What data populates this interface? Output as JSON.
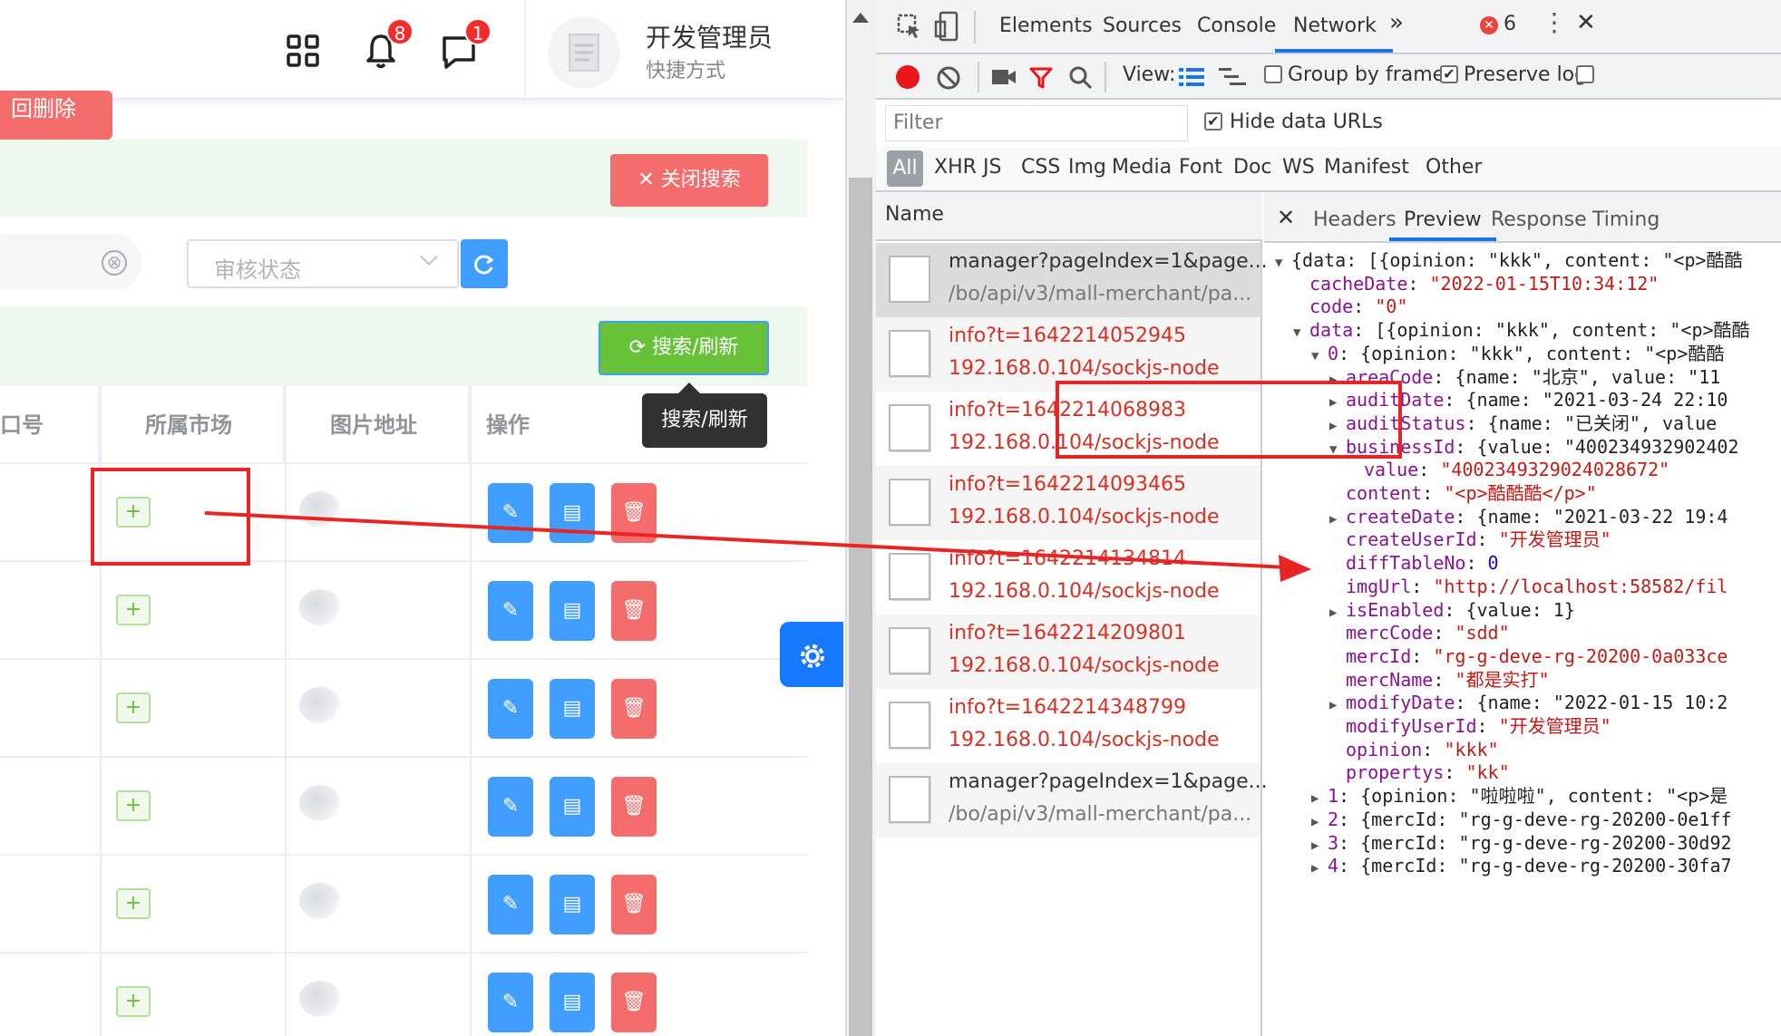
{
  "app": {
    "badges": {
      "bell": "8",
      "chat": "1"
    },
    "user": {
      "name": "开发管理员",
      "subtitle": "快捷方式"
    },
    "batch_delete_label": "回删除",
    "close_search_label": "关闭搜索",
    "keyword_clear_glyph": "⊗",
    "audit_status_placeholder": "审核状态",
    "search_refresh_label": "搜索/刷新",
    "tooltip": "搜索/刷新",
    "table": {
      "headers": [
        "口号",
        "所属市场",
        "图片地址",
        "操作"
      ],
      "rows": 6,
      "plus_glyph": "+"
    }
  },
  "devtools": {
    "tabs": [
      "Elements",
      "Sources",
      "Console",
      "Network"
    ],
    "more_tabs": "»",
    "error_count": "6",
    "toolbar": {
      "view_label": "View:",
      "group_by_frame": "Group by frame",
      "preserve_log": "Preserve log"
    },
    "filter_placeholder": "Filter",
    "hide_data_urls": "Hide data URLs",
    "types": [
      "All",
      "XHR",
      "JS",
      "CSS",
      "Img",
      "Media",
      "Font",
      "Doc",
      "WS",
      "Manifest",
      "Other"
    ],
    "name_header": "Name",
    "requests": [
      {
        "name": "manager?pageIndex=1&page...",
        "path": "/bo/api/v3/mall-merchant/pa...",
        "error": false,
        "selected": true
      },
      {
        "name": "info?t=1642214052945",
        "path": "192.168.0.104/sockjs-node",
        "error": true
      },
      {
        "name": "info?t=1642214068983",
        "path": "192.168.0.104/sockjs-node",
        "error": true
      },
      {
        "name": "info?t=1642214093465",
        "path": "192.168.0.104/sockjs-node",
        "error": true
      },
      {
        "name": "info?t=1642214134814",
        "path": "192.168.0.104/sockjs-node",
        "error": true
      },
      {
        "name": "info?t=1642214209801",
        "path": "192.168.0.104/sockjs-node",
        "error": true
      },
      {
        "name": "info?t=1642214348799",
        "path": "192.168.0.104/sockjs-node",
        "error": true
      },
      {
        "name": "manager?pageIndex=1&page...",
        "path": "/bo/api/v3/mall-merchant/pa...",
        "error": false
      }
    ],
    "preview_tabs": [
      "Headers",
      "Preview",
      "Response",
      "Timing"
    ],
    "json_lines": [
      {
        "i": 0,
        "t": "▼",
        "k": "",
        "v": "{data: [{opinion: \"kkk\", content: \"<p>酷酷",
        "c": "plain"
      },
      {
        "i": 1,
        "t": "",
        "k": "cacheDate",
        "v": "\"2022-01-15T10:34:12\"",
        "c": "str"
      },
      {
        "i": 1,
        "t": "",
        "k": "code",
        "v": "\"0\"",
        "c": "str"
      },
      {
        "i": 1,
        "t": "▼",
        "k": "data",
        "v": "[{opinion: \"kkk\", content: \"<p>酷酷",
        "c": "plain"
      },
      {
        "i": 2,
        "t": "▼",
        "k": "0",
        "v": "{opinion: \"kkk\", content: \"<p>酷酷",
        "c": "plain"
      },
      {
        "i": 3,
        "t": "▶",
        "k": "areaCode",
        "v": "{name: \"北京\", value: \"11",
        "c": "plain"
      },
      {
        "i": 3,
        "t": "▶",
        "k": "auditDate",
        "v": "{name: \"2021-03-24 22:10",
        "c": "plain"
      },
      {
        "i": 3,
        "t": "▶",
        "k": "auditStatus",
        "v": "{name: \"已关闭\", value",
        "c": "plain"
      },
      {
        "i": 3,
        "t": "▼",
        "k": "businessId",
        "v": "{value: \"400234932902402",
        "c": "plain"
      },
      {
        "i": 4,
        "t": "",
        "k": "value",
        "v": "\"4002349329024028672\"",
        "c": "str"
      },
      {
        "i": 3,
        "t": "",
        "k": "content",
        "v": "\"<p>酷酷酷</p>\"",
        "c": "str"
      },
      {
        "i": 3,
        "t": "▶",
        "k": "createDate",
        "v": "{name: \"2021-03-22 19:4",
        "c": "plain"
      },
      {
        "i": 3,
        "t": "",
        "k": "createUserId",
        "v": "\"开发管理员\"",
        "c": "str"
      },
      {
        "i": 3,
        "t": "",
        "k": "diffTableNo",
        "v": "0",
        "c": "num"
      },
      {
        "i": 3,
        "t": "",
        "k": "imgUrl",
        "v": "\"http://localhost:58582/fil",
        "c": "str"
      },
      {
        "i": 3,
        "t": "▶",
        "k": "isEnabled",
        "v": "{value: 1}",
        "c": "plain"
      },
      {
        "i": 3,
        "t": "",
        "k": "mercCode",
        "v": "\"sdd\"",
        "c": "str"
      },
      {
        "i": 3,
        "t": "",
        "k": "mercId",
        "v": "\"rg-g-deve-rg-20200-0a033ce",
        "c": "str"
      },
      {
        "i": 3,
        "t": "",
        "k": "mercName",
        "v": "\"都是实打\"",
        "c": "str"
      },
      {
        "i": 3,
        "t": "▶",
        "k": "modifyDate",
        "v": "{name: \"2022-01-15 10:2",
        "c": "plain"
      },
      {
        "i": 3,
        "t": "",
        "k": "modifyUserId",
        "v": "\"开发管理员\"",
        "c": "str"
      },
      {
        "i": 3,
        "t": "",
        "k": "opinion",
        "v": "\"kkk\"",
        "c": "str"
      },
      {
        "i": 3,
        "t": "",
        "k": "propertys",
        "v": "\"kk\"",
        "c": "str"
      },
      {
        "i": 2,
        "t": "▶",
        "k": "1",
        "v": "{opinion: \"啦啦啦\", content: \"<p>是",
        "c": "plain"
      },
      {
        "i": 2,
        "t": "▶",
        "k": "2",
        "v": "{mercId: \"rg-g-deve-rg-20200-0e1ff",
        "c": "plain"
      },
      {
        "i": 2,
        "t": "▶",
        "k": "3",
        "v": "{mercId: \"rg-g-deve-rg-20200-30d92",
        "c": "plain"
      },
      {
        "i": 2,
        "t": "▶",
        "k": "4",
        "v": "{mercId: \"rg-g-deve-rg-20200-30fa7",
        "c": "plain"
      }
    ]
  },
  "colors": {
    "highlight": "#e82525",
    "error_text": "#d93025",
    "accent": "#1a73e8"
  }
}
